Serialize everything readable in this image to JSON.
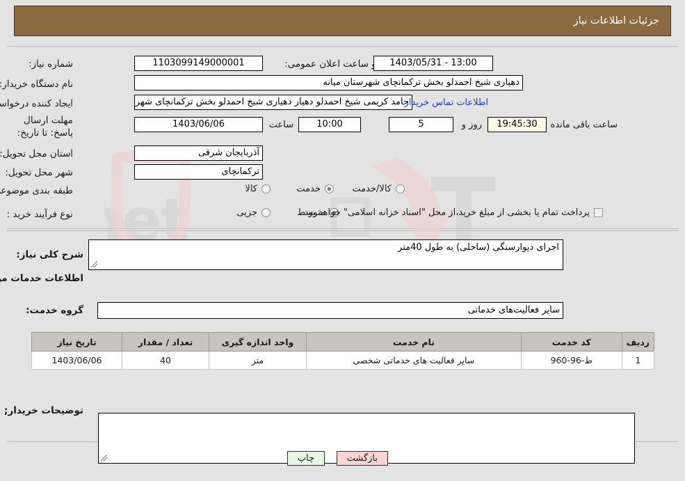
{
  "header": {
    "title": "جزئیات اطلاعات نیاز"
  },
  "fields": {
    "need_number_label": "شماره نیاز:",
    "need_number_value": "1103099149000001",
    "announce_label": "تاریخ و ساعت اعلان عمومی:",
    "announce_value": "13:00 - 1403/05/31",
    "buyer_org_label": "نام دستگاه خریدار:",
    "buyer_org_value": "دهیاری شیخ احمدلو بخش ترکمانچای شهرستان میانه",
    "creator_label": "ایجاد کننده درخواست:",
    "creator_value": "حامد کریمی شیخ احمدلو دهیار دهیاری شیخ احمدلو بخش ترکمانچای شهرستا",
    "contact_link": "اطلاعات تماس خریدار",
    "deadline_label": "مهلت ارسال پاسخ: تا تاریخ:",
    "deadline_date": "1403/06/06",
    "hour_label": "ساعت",
    "deadline_time": "10:00",
    "days_value": "5",
    "days_label": "روز و",
    "remaining_time": "19:45:30",
    "remaining_label": "ساعت باقی مانده",
    "province_label": "استان محل تحویل:",
    "province_value": "آذربایجان شرقی",
    "city_label": "شهر محل تحویل:",
    "city_value": "ترکمانچای",
    "category_label": "طبقه بندی موضوعی:",
    "category_options": [
      "کالا",
      "خدمت",
      "کالا/خدمت"
    ],
    "category_selected": "خدمت",
    "process_label": "نوع فرآیند خرید :",
    "process_options": [
      "جزیی",
      "متوسط"
    ],
    "process_selected": "متوسط",
    "treasury_note": "پرداخت تمام یا بخشی از مبلغ خرید،از محل \"اسناد خزانه اسلامی\" خواهد بود.",
    "treasury_checked": false
  },
  "description": {
    "need_desc_label": "شرح کلی نیاز:",
    "need_desc_value": "اجرای دیوارسنگی (ساحلی) به طول 40متر",
    "services_heading": "اطلاعات خدمات مورد نیاز",
    "service_group_label": "گروه خدمت:",
    "service_group_value": "سایر فعالیت‌های خدماتی",
    "buyer_notes_label": "توضیحات خریدار;",
    "buyer_notes_value": ""
  },
  "table": {
    "headers": [
      "ردیف",
      "کد خدمت",
      "نام خدمت",
      "واحد اندازه گیری",
      "تعداد / مقدار",
      "تاریخ نیاز"
    ],
    "rows": [
      {
        "row": "1",
        "code": "ط-96-960",
        "name": "سایر فعالیت های خدماتی شخصی",
        "unit": "متر",
        "qty": "40",
        "date": "1403/06/06"
      }
    ]
  },
  "footer": {
    "back_label": "بازگشت",
    "print_label": "چاپ"
  },
  "watermark": {
    "text": "AriaTender.net"
  },
  "colors": {
    "header_bg": "#8b6a42",
    "page_bg": "#e3e3e3",
    "link": "#1f3fbf",
    "back_btn": "#fbd5d5",
    "print_btn": "#e9f6e4",
    "table_header": "#c8c5c0",
    "cream_field": "#fdfbe8"
  }
}
